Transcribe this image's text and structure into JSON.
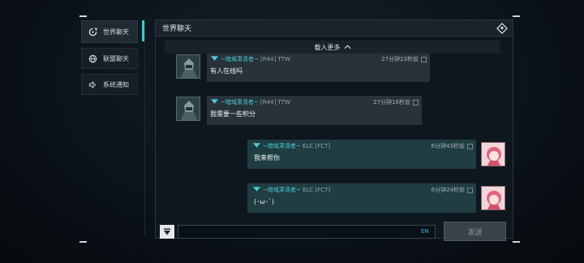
{
  "sidebar": {
    "items": [
      {
        "label": "世界聊天",
        "icon": "world-chat-icon",
        "active": true
      },
      {
        "label": "联盟聊天",
        "icon": "globe-icon",
        "active": false
      },
      {
        "label": "系统通知",
        "icon": "speaker-icon",
        "active": false
      }
    ]
  },
  "header": {
    "title": "世界聊天",
    "icon": "settings-diamond-icon"
  },
  "load_more": {
    "label": "载入更多",
    "icon": "chevron-up-icon"
  },
  "messages": [
    {
      "side": "left",
      "sender": "~暗域肃清者~",
      "rank": "[R44]",
      "tag": "TTW",
      "time": "27分钟23秒前",
      "text": "有人在线吗"
    },
    {
      "side": "left",
      "sender": "~暗域肃清者~",
      "rank": "[R44]",
      "tag": "TTW",
      "time": "27分钟16秒前",
      "text": "我需要一些积分"
    },
    {
      "side": "right",
      "sender": "~暗域肃清者~",
      "rank": "ELC",
      "tag": "[FCT]",
      "time": "6分钟43秒前",
      "text": "我来帮你"
    },
    {
      "side": "right",
      "sender": "~暗域肃清者~",
      "rank": "ELC",
      "tag": "[FCT]",
      "time": "6分钟24秒前",
      "text": "(･ω･`)"
    }
  ],
  "input": {
    "value": "",
    "placeholder": "",
    "lang": "EN"
  },
  "send": {
    "label": "发送"
  },
  "colors": {
    "accent": "#37c9c9",
    "name": "#4bc9d4",
    "bubble_left": "#27323b",
    "bubble_right": "#1f3d42"
  }
}
